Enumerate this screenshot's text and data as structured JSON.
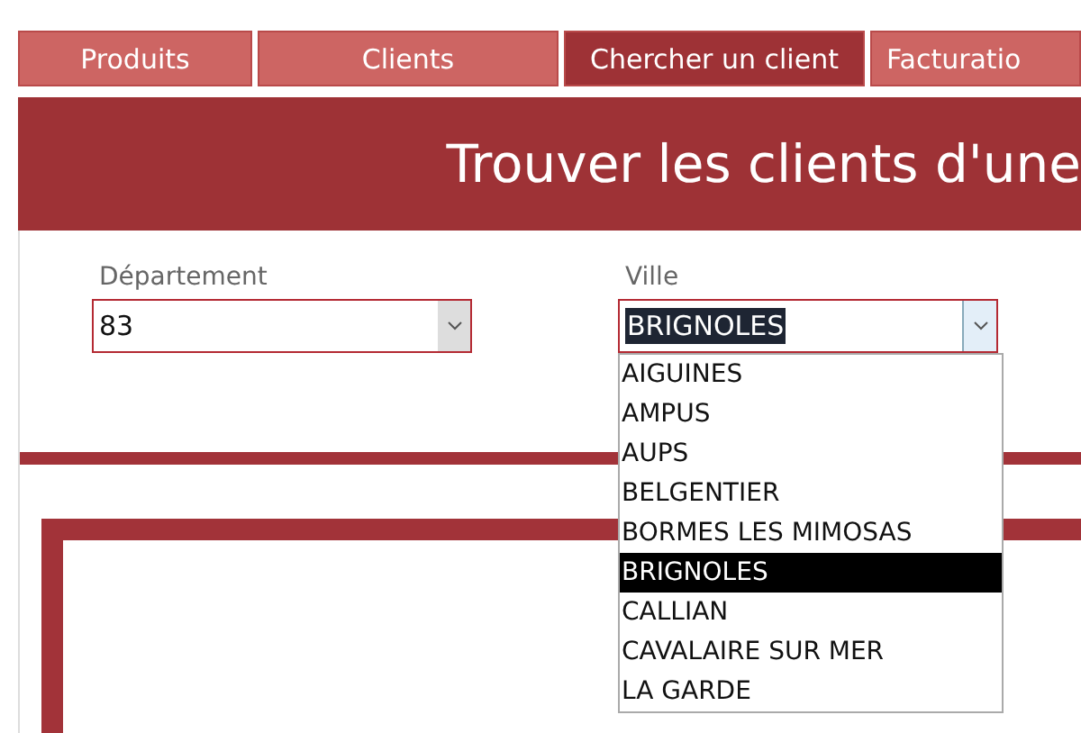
{
  "tabs": [
    {
      "label": "Produits",
      "selected": false
    },
    {
      "label": "Clients",
      "selected": false
    },
    {
      "label": "Chercher un client",
      "selected": true
    },
    {
      "label": "Facturatio",
      "selected": false
    }
  ],
  "header": {
    "title": "Trouver les clients d'une"
  },
  "filters": [
    {
      "label": "Département",
      "value": "83",
      "open": false,
      "text_selected": false
    },
    {
      "label": "Ville",
      "value": "BRIGNOLES",
      "open": true,
      "text_selected": true,
      "options": [
        {
          "label": "AIGUINES",
          "selected": false
        },
        {
          "label": "AMPUS",
          "selected": false
        },
        {
          "label": "AUPS",
          "selected": false
        },
        {
          "label": "BELGENTIER",
          "selected": false
        },
        {
          "label": "BORMES LES MIMOSAS",
          "selected": false
        },
        {
          "label": "BRIGNOLES",
          "selected": true
        },
        {
          "label": "CALLIAN",
          "selected": false
        },
        {
          "label": "CAVALAIRE SUR MER",
          "selected": false
        },
        {
          "label": "LA GARDE",
          "selected": false
        }
      ]
    }
  ]
}
